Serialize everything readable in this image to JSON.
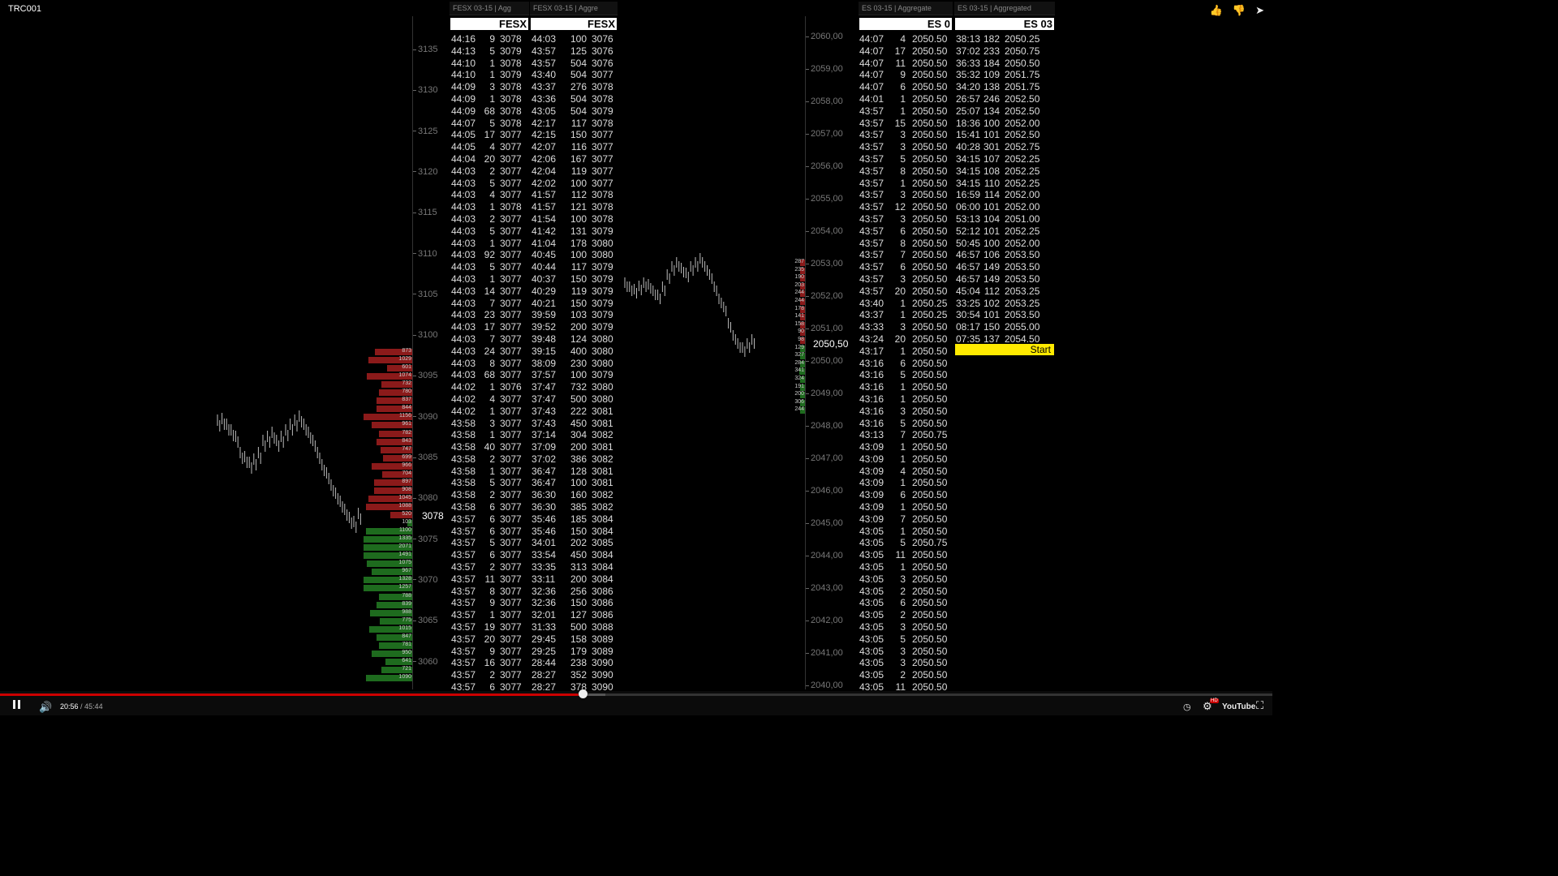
{
  "title": "TRC001",
  "fesx_axis_ticks": [
    "3135",
    "3130",
    "3125",
    "3120",
    "3115",
    "3110",
    "3105",
    "3100",
    "3095",
    "3090",
    "3085",
    "3080",
    "3075",
    "3070",
    "3065",
    "3060"
  ],
  "fesx_price_badge": "3078",
  "es_axis_ticks": [
    "2060,00",
    "2059,00",
    "2058,00",
    "2057,00",
    "2056,00",
    "2055,00",
    "2054,00",
    "2053,00",
    "2052,00",
    "2051,00",
    "2050,00",
    "2049,00",
    "2048,00",
    "2047,00",
    "2046,00",
    "2045,00",
    "2044,00",
    "2043,00",
    "2042,00",
    "2041,00",
    "2040,00"
  ],
  "es_price_badge": "2050,50",
  "fesx_volume_labels": [
    "873",
    "1029",
    "601",
    "1074",
    "732",
    "780",
    "837",
    "844",
    "1156",
    "961",
    "782",
    "843",
    "747",
    "699",
    "966",
    "704",
    "897",
    "908",
    "1045",
    "1088",
    "520",
    "103",
    "1100",
    "1335",
    "2071",
    "1491",
    "1075",
    "967",
    "1328",
    "1257",
    "788",
    "839",
    "988",
    "775",
    "1015",
    "847",
    "781",
    "950",
    "641",
    "721",
    "1090"
  ],
  "es_volume_labels": [
    "287",
    "235",
    "190",
    "203",
    "244",
    "244",
    "178",
    "141",
    "158",
    "90",
    "98",
    "129",
    "327",
    "284",
    "341",
    "324",
    "191",
    "200",
    "306",
    "244"
  ],
  "tas": [
    {
      "tab": "FESX 03-15 | Agg",
      "header": "FESX",
      "rows": [
        [
          "44:16",
          "9",
          "3078"
        ],
        [
          "44:13",
          "5",
          "3079"
        ],
        [
          "44:10",
          "1",
          "3078"
        ],
        [
          "44:10",
          "1",
          "3079"
        ],
        [
          "44:09",
          "3",
          "3078"
        ],
        [
          "44:09",
          "1",
          "3078"
        ],
        [
          "44:09",
          "68",
          "3078"
        ],
        [
          "44:07",
          "5",
          "3078"
        ],
        [
          "44:05",
          "17",
          "3077"
        ],
        [
          "44:05",
          "4",
          "3077"
        ],
        [
          "44:04",
          "20",
          "3077"
        ],
        [
          "44:03",
          "2",
          "3077"
        ],
        [
          "44:03",
          "5",
          "3077"
        ],
        [
          "44:03",
          "4",
          "3077"
        ],
        [
          "44:03",
          "1",
          "3078"
        ],
        [
          "44:03",
          "2",
          "3077"
        ],
        [
          "44:03",
          "5",
          "3077"
        ],
        [
          "44:03",
          "1",
          "3077"
        ],
        [
          "44:03",
          "92",
          "3077"
        ],
        [
          "44:03",
          "5",
          "3077"
        ],
        [
          "44:03",
          "1",
          "3077"
        ],
        [
          "44:03",
          "14",
          "3077"
        ],
        [
          "44:03",
          "7",
          "3077"
        ],
        [
          "44:03",
          "23",
          "3077"
        ],
        [
          "44:03",
          "17",
          "3077"
        ],
        [
          "44:03",
          "7",
          "3077"
        ],
        [
          "44:03",
          "24",
          "3077"
        ],
        [
          "44:03",
          "8",
          "3077"
        ],
        [
          "44:03",
          "68",
          "3077"
        ],
        [
          "44:02",
          "1",
          "3076"
        ],
        [
          "44:02",
          "4",
          "3077"
        ],
        [
          "44:02",
          "1",
          "3077"
        ],
        [
          "43:58",
          "3",
          "3077"
        ],
        [
          "43:58",
          "1",
          "3077"
        ],
        [
          "43:58",
          "40",
          "3077"
        ],
        [
          "43:58",
          "2",
          "3077"
        ],
        [
          "43:58",
          "1",
          "3077"
        ],
        [
          "43:58",
          "5",
          "3077"
        ],
        [
          "43:58",
          "2",
          "3077"
        ],
        [
          "43:58",
          "6",
          "3077"
        ],
        [
          "43:57",
          "6",
          "3077"
        ],
        [
          "43:57",
          "6",
          "3077"
        ],
        [
          "43:57",
          "5",
          "3077"
        ],
        [
          "43:57",
          "6",
          "3077"
        ],
        [
          "43:57",
          "2",
          "3077"
        ],
        [
          "43:57",
          "11",
          "3077"
        ],
        [
          "43:57",
          "8",
          "3077"
        ],
        [
          "43:57",
          "9",
          "3077"
        ],
        [
          "43:57",
          "1",
          "3077"
        ],
        [
          "43:57",
          "19",
          "3077"
        ],
        [
          "43:57",
          "20",
          "3077"
        ],
        [
          "43:57",
          "9",
          "3077"
        ],
        [
          "43:57",
          "16",
          "3077"
        ],
        [
          "43:57",
          "2",
          "3077"
        ],
        [
          "43:57",
          "6",
          "3077"
        ]
      ]
    },
    {
      "tab": "FESX 03-15 | Aggre",
      "header": "FESX",
      "rows": [
        [
          "44:03",
          "100",
          "3076"
        ],
        [
          "43:57",
          "125",
          "3076"
        ],
        [
          "43:57",
          "504",
          "3076"
        ],
        [
          "43:40",
          "504",
          "3077"
        ],
        [
          "43:37",
          "276",
          "3078"
        ],
        [
          "43:36",
          "504",
          "3078"
        ],
        [
          "43:05",
          "504",
          "3079"
        ],
        [
          "42:17",
          "117",
          "3078"
        ],
        [
          "42:15",
          "150",
          "3077"
        ],
        [
          "42:07",
          "116",
          "3077"
        ],
        [
          "42:06",
          "167",
          "3077"
        ],
        [
          "42:04",
          "119",
          "3077"
        ],
        [
          "42:02",
          "100",
          "3077"
        ],
        [
          "41:57",
          "112",
          "3078"
        ],
        [
          "41:57",
          "121",
          "3078"
        ],
        [
          "41:54",
          "100",
          "3078"
        ],
        [
          "41:42",
          "131",
          "3079"
        ],
        [
          "41:04",
          "178",
          "3080"
        ],
        [
          "40:45",
          "100",
          "3080"
        ],
        [
          "40:44",
          "117",
          "3079"
        ],
        [
          "40:37",
          "150",
          "3079"
        ],
        [
          "40:29",
          "119",
          "3079"
        ],
        [
          "40:21",
          "150",
          "3079"
        ],
        [
          "39:59",
          "103",
          "3079"
        ],
        [
          "39:52",
          "200",
          "3079"
        ],
        [
          "39:48",
          "124",
          "3080"
        ],
        [
          "39:15",
          "400",
          "3080"
        ],
        [
          "38:09",
          "230",
          "3080"
        ],
        [
          "37:57",
          "100",
          "3079"
        ],
        [
          "37:47",
          "732",
          "3080"
        ],
        [
          "37:47",
          "500",
          "3080"
        ],
        [
          "37:43",
          "222",
          "3081"
        ],
        [
          "37:43",
          "450",
          "3081"
        ],
        [
          "37:14",
          "304",
          "3082"
        ],
        [
          "37:09",
          "200",
          "3081"
        ],
        [
          "37:02",
          "386",
          "3082"
        ],
        [
          "36:47",
          "128",
          "3081"
        ],
        [
          "36:47",
          "100",
          "3081"
        ],
        [
          "36:30",
          "160",
          "3082"
        ],
        [
          "36:30",
          "385",
          "3082"
        ],
        [
          "35:46",
          "185",
          "3084"
        ],
        [
          "35:46",
          "150",
          "3084"
        ],
        [
          "34:01",
          "202",
          "3085"
        ],
        [
          "33:54",
          "450",
          "3084"
        ],
        [
          "33:35",
          "313",
          "3084"
        ],
        [
          "33:11",
          "200",
          "3084"
        ],
        [
          "32:36",
          "256",
          "3086"
        ],
        [
          "32:36",
          "150",
          "3086"
        ],
        [
          "32:01",
          "127",
          "3086"
        ],
        [
          "31:33",
          "500",
          "3088"
        ],
        [
          "29:45",
          "158",
          "3089"
        ],
        [
          "29:25",
          "179",
          "3089"
        ],
        [
          "28:44",
          "238",
          "3090"
        ],
        [
          "28:27",
          "352",
          "3090"
        ],
        [
          "28:27",
          "378",
          "3090"
        ]
      ]
    },
    {
      "tab": "ES 03-15 | Aggregate",
      "header": "ES 0",
      "rows": [
        [
          "44:07",
          "4",
          "2050.50"
        ],
        [
          "44:07",
          "17",
          "2050.50"
        ],
        [
          "44:07",
          "11",
          "2050.50"
        ],
        [
          "44:07",
          "9",
          "2050.50"
        ],
        [
          "44:07",
          "6",
          "2050.50"
        ],
        [
          "44:01",
          "1",
          "2050.50"
        ],
        [
          "43:57",
          "1",
          "2050.50"
        ],
        [
          "43:57",
          "15",
          "2050.50"
        ],
        [
          "43:57",
          "3",
          "2050.50"
        ],
        [
          "43:57",
          "3",
          "2050.50"
        ],
        [
          "43:57",
          "5",
          "2050.50"
        ],
        [
          "43:57",
          "8",
          "2050.50"
        ],
        [
          "43:57",
          "1",
          "2050.50"
        ],
        [
          "43:57",
          "3",
          "2050.50"
        ],
        [
          "43:57",
          "12",
          "2050.50"
        ],
        [
          "43:57",
          "3",
          "2050.50"
        ],
        [
          "43:57",
          "6",
          "2050.50"
        ],
        [
          "43:57",
          "8",
          "2050.50"
        ],
        [
          "43:57",
          "7",
          "2050.50"
        ],
        [
          "43:57",
          "6",
          "2050.50"
        ],
        [
          "43:57",
          "3",
          "2050.50"
        ],
        [
          "43:57",
          "20",
          "2050.50"
        ],
        [
          "43:40",
          "1",
          "2050.25"
        ],
        [
          "43:37",
          "1",
          "2050.25"
        ],
        [
          "43:33",
          "3",
          "2050.50"
        ],
        [
          "43:24",
          "20",
          "2050.50"
        ],
        [
          "43:17",
          "1",
          "2050.50"
        ],
        [
          "43:16",
          "6",
          "2050.50"
        ],
        [
          "43:16",
          "5",
          "2050.50"
        ],
        [
          "43:16",
          "1",
          "2050.50"
        ],
        [
          "43:16",
          "1",
          "2050.50"
        ],
        [
          "43:16",
          "3",
          "2050.50"
        ],
        [
          "43:16",
          "5",
          "2050.50"
        ],
        [
          "43:13",
          "7",
          "2050.75"
        ],
        [
          "43:09",
          "1",
          "2050.50"
        ],
        [
          "43:09",
          "1",
          "2050.50"
        ],
        [
          "43:09",
          "4",
          "2050.50"
        ],
        [
          "43:09",
          "1",
          "2050.50"
        ],
        [
          "43:09",
          "6",
          "2050.50"
        ],
        [
          "43:09",
          "1",
          "2050.50"
        ],
        [
          "43:09",
          "7",
          "2050.50"
        ],
        [
          "43:05",
          "1",
          "2050.50"
        ],
        [
          "43:05",
          "5",
          "2050.75"
        ],
        [
          "43:05",
          "11",
          "2050.50"
        ],
        [
          "43:05",
          "1",
          "2050.50"
        ],
        [
          "43:05",
          "3",
          "2050.50"
        ],
        [
          "43:05",
          "2",
          "2050.50"
        ],
        [
          "43:05",
          "6",
          "2050.50"
        ],
        [
          "43:05",
          "2",
          "2050.50"
        ],
        [
          "43:05",
          "3",
          "2050.50"
        ],
        [
          "43:05",
          "5",
          "2050.50"
        ],
        [
          "43:05",
          "3",
          "2050.50"
        ],
        [
          "43:05",
          "3",
          "2050.50"
        ],
        [
          "43:05",
          "2",
          "2050.50"
        ],
        [
          "43:05",
          "11",
          "2050.50"
        ]
      ]
    },
    {
      "tab": "ES 03-15 | Aggregated",
      "header": "ES 03",
      "rows": [
        [
          "38:13",
          "182",
          "2050.25"
        ],
        [
          "37:02",
          "233",
          "2050.75"
        ],
        [
          "36:33",
          "184",
          "2050.50"
        ],
        [
          "35:32",
          "109",
          "2051.75"
        ],
        [
          "34:20",
          "138",
          "2051.75"
        ],
        [
          "26:57",
          "246",
          "2052.50"
        ],
        [
          "25:07",
          "134",
          "2052.50"
        ],
        [
          "18:36",
          "100",
          "2052.00"
        ],
        [
          "15:41",
          "101",
          "2052.50"
        ],
        [
          "40:28",
          "301",
          "2052.75"
        ],
        [
          "34:15",
          "107",
          "2052.25"
        ],
        [
          "34:15",
          "108",
          "2052.25"
        ],
        [
          "34:15",
          "110",
          "2052.25"
        ],
        [
          "16:59",
          "114",
          "2052.00"
        ],
        [
          "06:00",
          "101",
          "2052.00"
        ],
        [
          "53:13",
          "104",
          "2051.00"
        ],
        [
          "52:12",
          "101",
          "2052.25"
        ],
        [
          "50:45",
          "100",
          "2052.00"
        ],
        [
          "46:57",
          "106",
          "2053.50"
        ],
        [
          "46:57",
          "149",
          "2053.50"
        ],
        [
          "46:57",
          "149",
          "2053.50"
        ],
        [
          "45:04",
          "112",
          "2053.25"
        ],
        [
          "33:25",
          "102",
          "2053.25"
        ],
        [
          "30:54",
          "101",
          "2053.50"
        ],
        [
          "08:17",
          "150",
          "2055.00"
        ],
        [
          "07:35",
          "137",
          "2054.50"
        ]
      ],
      "start_label": "Start"
    }
  ],
  "player": {
    "current_time": "20:56",
    "separator": " / ",
    "duration": "45:44",
    "progress_fraction": 0.458,
    "buffer_fraction": 0.476,
    "youtube_label": "YouTube",
    "hd_badge": "HD"
  },
  "colors": {
    "progress": "#cc0000",
    "ask_volume": "#8b1a1a",
    "bid_volume": "#1e6b1e",
    "start_button": "#ffea00"
  }
}
